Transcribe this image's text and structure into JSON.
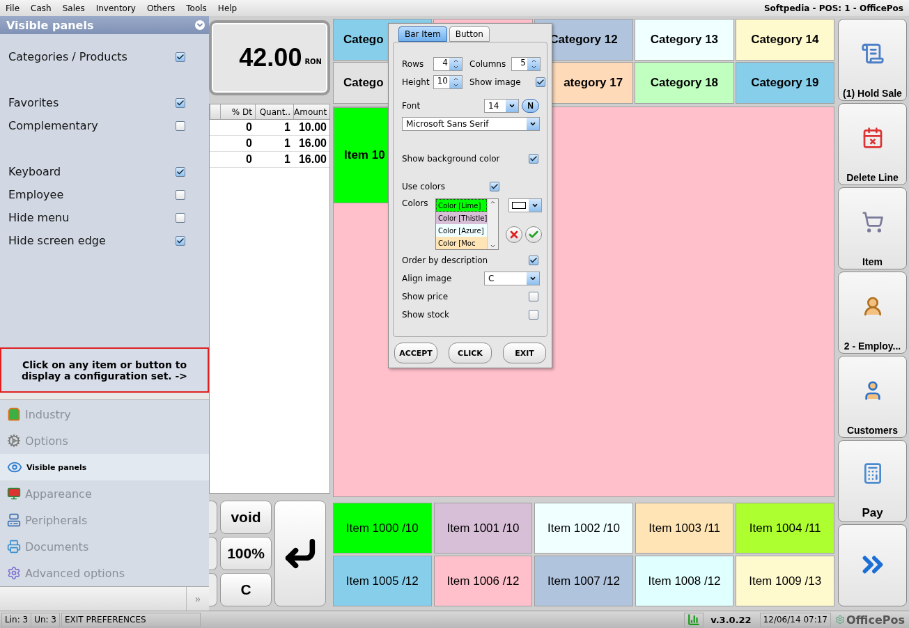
{
  "menu": [
    "File",
    "Cash",
    "Sales",
    "Inventory",
    "Others",
    "Tools",
    "Help"
  ],
  "title": "Softpedia - POS: 1 - OfficePos",
  "panel": {
    "title": "Visible panels",
    "groups": [
      [
        {
          "label": "Categories / Products",
          "checked": true
        }
      ],
      [
        {
          "label": "Favorites",
          "checked": true
        },
        {
          "label": "Complementary",
          "checked": false
        }
      ],
      [
        {
          "label": "Keyboard",
          "checked": true
        },
        {
          "label": "Employee",
          "checked": false
        },
        {
          "label": "Hide menu",
          "checked": false
        },
        {
          "label": "Hide screen edge",
          "checked": true
        }
      ]
    ],
    "hint": "Click on any item or button to display a configuration set. ->",
    "nav": [
      {
        "label": "Industry",
        "kind": "industry",
        "selected": false
      },
      {
        "label": "Options",
        "kind": "options",
        "selected": false
      },
      {
        "label": "Visible panels",
        "kind": "visible",
        "selected": true
      },
      {
        "label": "Appareance",
        "kind": "appearance",
        "selected": false
      },
      {
        "label": "Peripherals",
        "kind": "peripherals",
        "selected": false
      },
      {
        "label": "Documents",
        "kind": "documents",
        "selected": false
      },
      {
        "label": "Advanced options",
        "kind": "advanced",
        "selected": false
      }
    ],
    "more": "»"
  },
  "display": {
    "amount": "42.00",
    "currency": "RON"
  },
  "table": {
    "columns": [
      "% Dt",
      "Quant..",
      "Amount"
    ],
    "rows": [
      {
        "discount": "0",
        "quantity": "1",
        "amount": "10.00"
      },
      {
        "discount": "0",
        "quantity": "1",
        "amount": "16.00"
      },
      {
        "discount": "0",
        "quantity": "1",
        "amount": "16.00"
      }
    ]
  },
  "keypad": [
    "void",
    "100%",
    "C"
  ],
  "categories": [
    {
      "label": "Catego",
      "color": "#87ceeb",
      "kind": "cut_end"
    },
    {
      "color": "#ffc0cb",
      "kind": "hidden"
    },
    {
      "label": "Category 12",
      "color": "#b0c4de",
      "kind": "full"
    },
    {
      "label": "Category 13",
      "color": "#f0ffff",
      "kind": "full"
    },
    {
      "label": "Category 14",
      "color": "#fffacd",
      "kind": "full"
    },
    {
      "label": "Catego",
      "color": "#e2e2e2",
      "kind": "cut_end"
    },
    {
      "kind": "hidden"
    },
    {
      "label": "ategory 17",
      "color": "#ffdab9",
      "kind": "cut_start"
    },
    {
      "label": "Category 18",
      "color": "#c1ffc1",
      "kind": "full"
    },
    {
      "label": "Category 19",
      "color": "#87ceeb",
      "kind": "full"
    }
  ],
  "panel_items": [
    {
      "label": "Item 10",
      "color": "#00ff00"
    }
  ],
  "items": [
    {
      "label": "Item 1000 /10",
      "color": "#00ff00"
    },
    {
      "label": "Item 1001 /10",
      "color": "#d8bfd8"
    },
    {
      "label": "Item 1002 /10",
      "color": "#f0ffff"
    },
    {
      "label": "Item 1003 /11",
      "color": "#ffe4b5"
    },
    {
      "label": "Item 1004 /11",
      "color": "#adff2f"
    },
    {
      "label": "Item 1005 /12",
      "color": "#87ceeb"
    },
    {
      "label": "Item 1006 /12",
      "color": "#ffc0cb"
    },
    {
      "label": "Item 1007 /12",
      "color": "#b0c4de"
    },
    {
      "label": "Item 1008 /12",
      "color": "#e0ffff"
    },
    {
      "label": "Item 1009 /13",
      "color": "#fffacd"
    }
  ],
  "actions": [
    {
      "label": "(1) Hold Sale",
      "kind": "hold"
    },
    {
      "label": "Delete Line",
      "kind": "delete"
    },
    {
      "label": "Item",
      "kind": "item"
    },
    {
      "label": "2 - Employ...",
      "kind": "employee"
    },
    {
      "label": "Customers",
      "kind": "customers"
    },
    {
      "label": "Pay",
      "kind": "pay"
    },
    {
      "kind": "next"
    }
  ],
  "dialog": {
    "tabs": [
      {
        "label": "Bar Item",
        "selected": true
      },
      {
        "label": "Button",
        "selected": false
      }
    ],
    "rows": {
      "label": "Rows",
      "value": "4"
    },
    "columns": {
      "label": "Columns",
      "value": "5"
    },
    "height": {
      "label": "Height",
      "value": "10"
    },
    "show_image": {
      "label": "Show image",
      "checked": true
    },
    "font": {
      "label": "Font",
      "size": "14",
      "style": "N",
      "family": "Microsoft Sans Serif"
    },
    "show_background": {
      "label": "Show background color",
      "checked": true
    },
    "use_colors": {
      "label": "Use colors",
      "checked": true
    },
    "colors": {
      "label": "Colors",
      "items": [
        {
          "label": "Color [Lime]",
          "color": "#00ff00",
          "selected": true
        },
        {
          "label": "Color [Thistle]",
          "color": "#d8bfd8",
          "selected": false
        },
        {
          "label": "Color [Azure]",
          "color": "#f0ffff",
          "selected": false
        },
        {
          "label": "Color [Moc",
          "color": "#ffe4b5",
          "selected": false
        }
      ]
    },
    "order_by": {
      "label": "Order by description",
      "checked": true
    },
    "align_image": {
      "label": "Align image",
      "value": "C"
    },
    "show_price": {
      "label": "Show price",
      "checked": false
    },
    "show_stock": {
      "label": "Show stock",
      "checked": false
    },
    "buttons": [
      "ACCEPT",
      "CLICK",
      "EXIT"
    ]
  },
  "status": {
    "lines": "Lin: 3",
    "units": "Un: 3",
    "message": "EXIT PREFERENCES",
    "version": "v.3.0.22",
    "datetime": "12/06/14 07:17",
    "brand": "OfficePos"
  }
}
